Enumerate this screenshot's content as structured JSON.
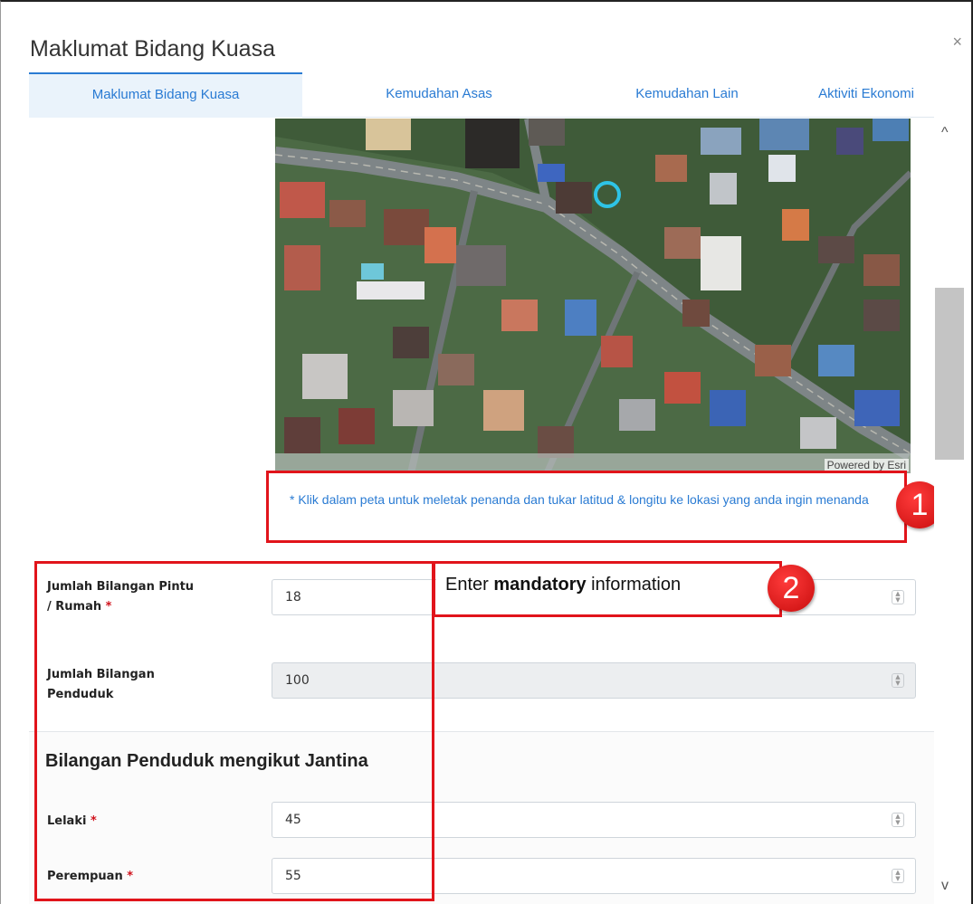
{
  "modal": {
    "title": "Maklumat Bidang Kuasa",
    "close": "×"
  },
  "tabs": [
    {
      "label": "Maklumat Bidang Kuasa",
      "active": true
    },
    {
      "label": "Kemudahan Asas",
      "active": false
    },
    {
      "label": "Kemudahan Lain",
      "active": false
    },
    {
      "label": "Aktiviti Ekonomi",
      "active": false
    }
  ],
  "map": {
    "attribution": "Powered by Esri"
  },
  "hint": "* Klik dalam peta untuk meletak penanda dan tukar latitud & longitu ke lokasi yang anda ingin menanda",
  "annotations": {
    "badge1": "1",
    "badge2": "2",
    "callout_pre": "Enter ",
    "callout_bold": "mandatory",
    "callout_post": " information"
  },
  "form": {
    "pintu": {
      "label_line1": "Jumlah Bilangan Pintu",
      "label_line2": "/ Rumah",
      "required": "*",
      "value": "18"
    },
    "penduduk": {
      "label_line1": "Jumlah Bilangan",
      "label_line2": "Penduduk",
      "value": "100"
    },
    "section_title": "Bilangan Penduduk mengikut Jantina",
    "lelaki": {
      "label": "Lelaki",
      "required": "*",
      "value": "45"
    },
    "perempuan": {
      "label": "Perempuan",
      "required": "*",
      "value": "55"
    }
  },
  "scroll": {
    "up": "^",
    "down": "v"
  },
  "colors": {
    "accent": "#2a7bd3",
    "annotation": "#e1141b",
    "required": "#d0111b"
  }
}
